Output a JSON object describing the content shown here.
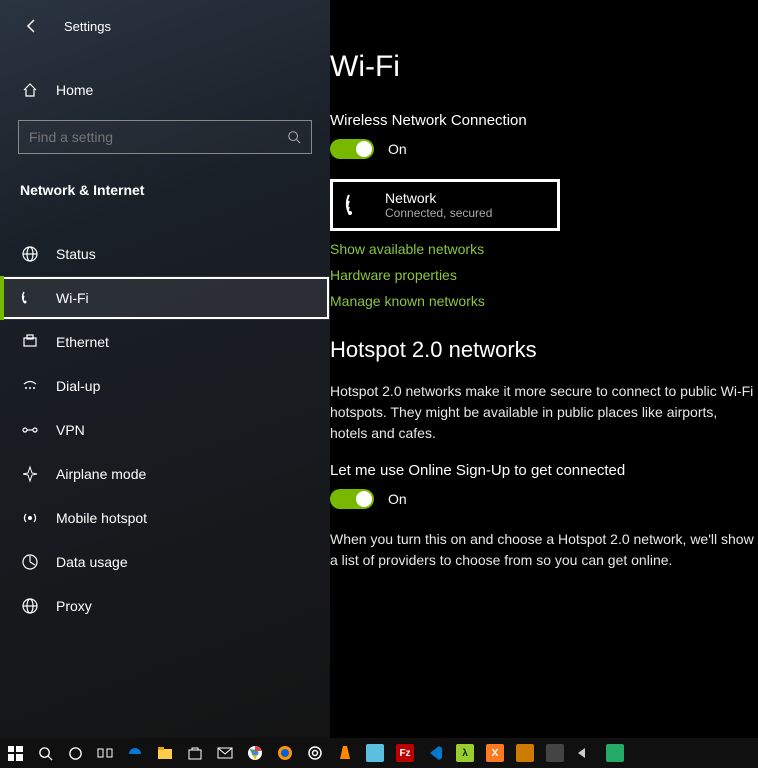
{
  "titlebar": {
    "app": "Settings"
  },
  "sidebar": {
    "home": "Home",
    "search_placeholder": "Find a setting",
    "section": "Network & Internet",
    "items": [
      {
        "label": "Status"
      },
      {
        "label": "Wi-Fi"
      },
      {
        "label": "Ethernet"
      },
      {
        "label": "Dial-up"
      },
      {
        "label": "VPN"
      },
      {
        "label": "Airplane mode"
      },
      {
        "label": "Mobile hotspot"
      },
      {
        "label": "Data usage"
      },
      {
        "label": "Proxy"
      }
    ]
  },
  "content": {
    "title": "Wi-Fi",
    "wireless_heading": "Wireless Network Connection",
    "wireless_toggle": "On",
    "network": {
      "name": "Network",
      "status": "Connected, secured"
    },
    "links": {
      "show": "Show available networks",
      "hw": "Hardware properties",
      "known": "Manage known networks"
    },
    "hotspot_heading": "Hotspot 2.0 networks",
    "hotspot_body": "Hotspot 2.0 networks make it more secure to connect to public Wi-Fi hotspots. They might be available in public places like airports, hotels and cafes.",
    "signup_label": "Let me use Online Sign-Up to get connected",
    "signup_toggle": "On",
    "signup_body": "When you turn this on and choose a Hotspot 2.0 network, we'll show a list of providers to choose from so you can get online."
  }
}
